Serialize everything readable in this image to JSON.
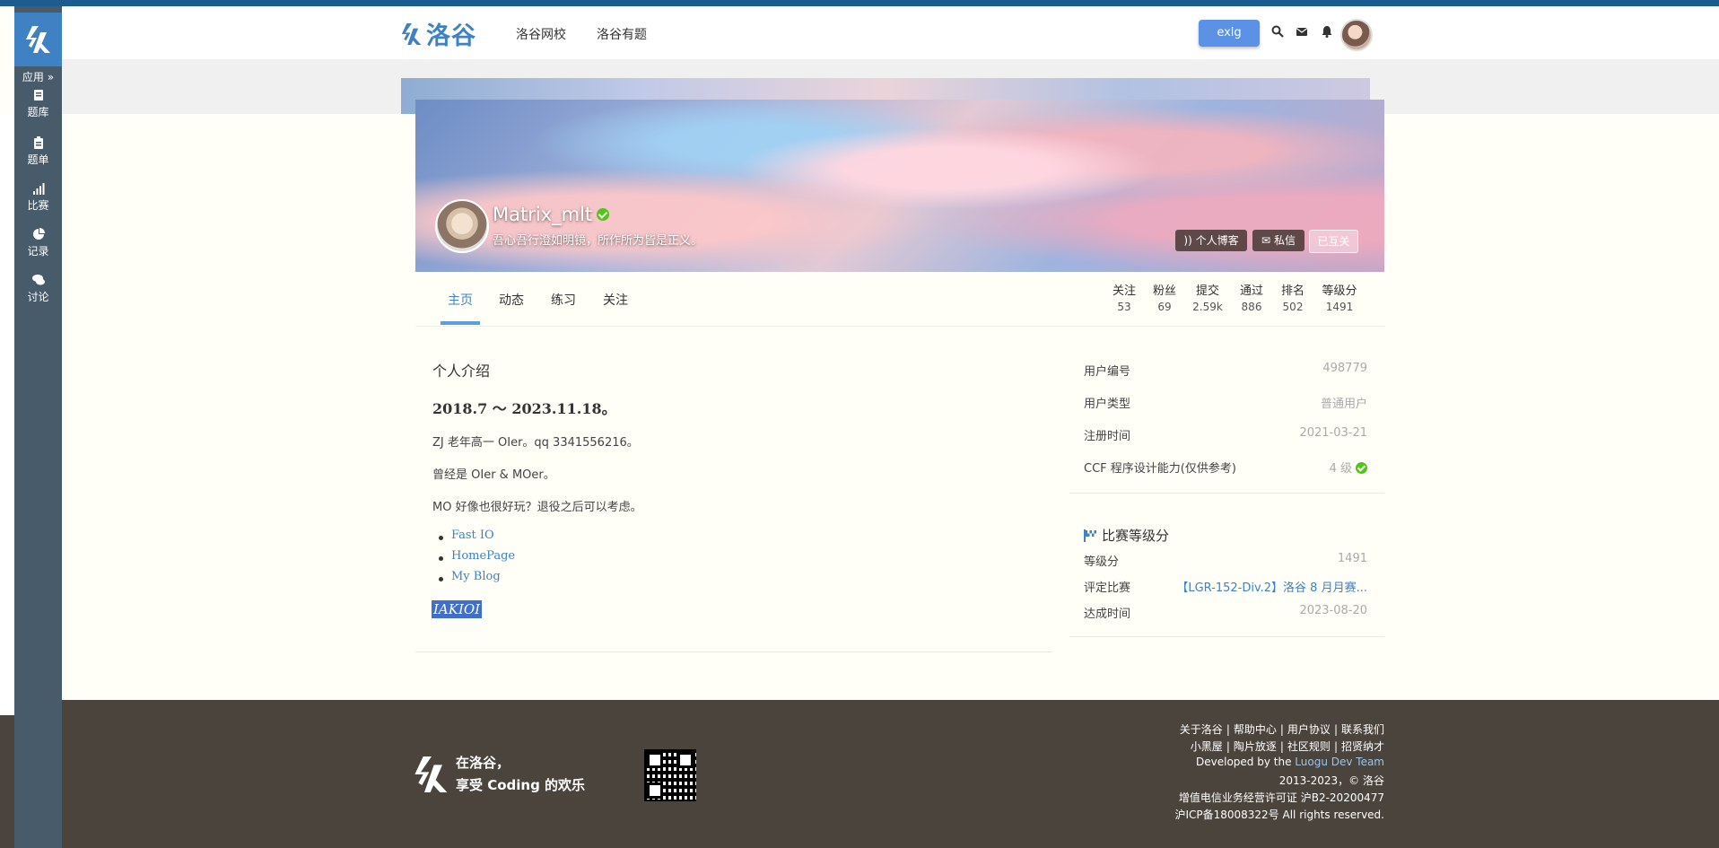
{
  "sidebar": {
    "apps_label": "应用 »",
    "items": [
      {
        "label": "题库",
        "icon": "book-icon"
      },
      {
        "label": "题单",
        "icon": "clipboard-icon"
      },
      {
        "label": "比赛",
        "icon": "bar-chart-icon"
      },
      {
        "label": "记录",
        "icon": "pie-chart-icon"
      },
      {
        "label": "讨论",
        "icon": "comments-icon"
      }
    ]
  },
  "header": {
    "brand": "洛谷",
    "nav": [
      "洛谷网校",
      "洛谷有题"
    ],
    "exlg_label": "exlg"
  },
  "profile": {
    "name": "Matrix_mlt",
    "slogan": "吾心吾行澄如明镜，所作所为皆是正义。",
    "buttons": {
      "blog": "个人博客",
      "message": "私信",
      "follow": "已互关"
    }
  },
  "tabs": [
    "主页",
    "动态",
    "练习",
    "关注"
  ],
  "stats": [
    {
      "label": "关注",
      "value": "53"
    },
    {
      "label": "粉丝",
      "value": "69"
    },
    {
      "label": "提交",
      "value": "2.59k"
    },
    {
      "label": "通过",
      "value": "886"
    },
    {
      "label": "排名",
      "value": "502"
    },
    {
      "label": "等级分",
      "value": "1491"
    }
  ],
  "intro": {
    "heading": "个人介绍",
    "date_range": "2018.7 ～ 2023.11.18。",
    "lines": [
      "ZJ 老年高一 OIer。qq 3341556216。",
      "曾经是 OIer & MOer。",
      "MO 好像也很好玩？退役之后可以考虑。"
    ],
    "links": [
      "Fast IO",
      "HomePage",
      "My Blog"
    ],
    "highlight": "IAKIOI"
  },
  "user_info": [
    {
      "key": "用户编号",
      "value": "498779"
    },
    {
      "key": "用户类型",
      "value": "普通用户"
    },
    {
      "key": "注册时间",
      "value": "2021-03-21"
    },
    {
      "key": "CCF 程序设计能力(仅供参考)",
      "value": "4 级"
    }
  ],
  "contest": {
    "title": "比赛等级分",
    "rows": [
      {
        "key": "等级分",
        "value": "1491"
      },
      {
        "key": "评定比赛",
        "value": "【LGR-152-Div.2】洛谷 8 月月赛..."
      },
      {
        "key": "达成时间",
        "value": "2023-08-20"
      }
    ]
  },
  "footer": {
    "slogan_line1": "在洛谷，",
    "slogan_line2": "享受 Coding 的欢乐",
    "links_row1": [
      "关于洛谷",
      "帮助中心",
      "用户协议",
      "联系我们"
    ],
    "links_row2": [
      "小黑屋",
      "陶片放逐",
      "社区规则",
      "招贤纳才"
    ],
    "dev_prefix": "Developed by the ",
    "dev_team": "Luogu Dev Team",
    "copyright": "2013-2023，© 洛谷",
    "license": "增值电信业务经营许可证 沪B2-20200477",
    "icp": "沪ICP备18008322号 All rights reserved."
  },
  "colors": {
    "brand": "#3e82c4",
    "sidebar": "#485b6b",
    "footer": "#4b443d",
    "accent_button": "#5b92e5",
    "verified": "#52c41a"
  }
}
